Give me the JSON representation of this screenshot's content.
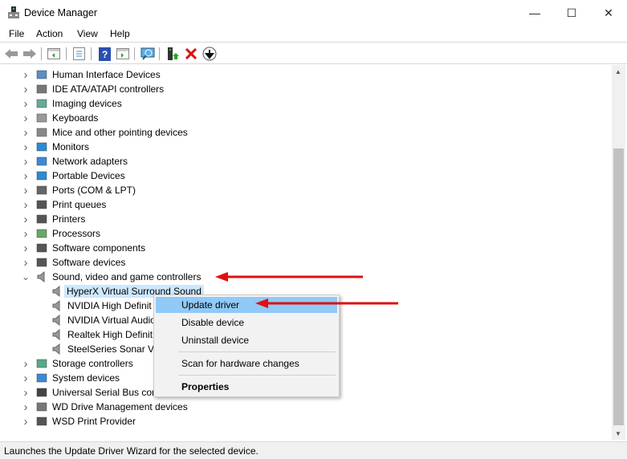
{
  "window": {
    "title": "Device Manager",
    "controls": [
      "minimize",
      "maximize",
      "close"
    ]
  },
  "menubar": [
    "File",
    "Action",
    "View",
    "Help"
  ],
  "toolbar": [
    "back-icon",
    "forward-icon",
    "show-hide-console-tree-icon",
    "properties-icon",
    "help-icon",
    "action-pane-icon",
    "scan-hardware-icon",
    "update-driver-icon",
    "uninstall-icon",
    "disable-icon"
  ],
  "tree": {
    "categories_top": [
      "Human Interface Devices",
      "IDE ATA/ATAPI controllers",
      "Imaging devices",
      "Keyboards",
      "Mice and other pointing devices",
      "Monitors",
      "Network adapters",
      "Portable Devices",
      "Ports (COM & LPT)",
      "Print queues",
      "Printers",
      "Processors",
      "Software components",
      "Software devices"
    ],
    "expanded": "Sound, video and game controllers",
    "children": [
      "HyperX Virtual Surround Sound",
      "NVIDIA High Definit",
      "NVIDIA Virtual Audio",
      "Realtek High Definit",
      "SteelSeries Sonar Vir"
    ],
    "selected_child": "HyperX Virtual Surround Sound",
    "categories_bottom": [
      "Storage controllers",
      "System devices",
      "Universal Serial Bus controllers",
      "WD Drive Management devices",
      "WSD Print Provider"
    ]
  },
  "context_menu": {
    "update": "Update driver",
    "disable": "Disable device",
    "uninstall": "Uninstall device",
    "scan": "Scan for hardware changes",
    "properties": "Properties"
  },
  "status": "Launches the Update Driver Wizard for the selected device.",
  "colors": {
    "selection": "#cce8ff",
    "menu_highlight": "#91c9f7",
    "arrow": "#e01010"
  }
}
